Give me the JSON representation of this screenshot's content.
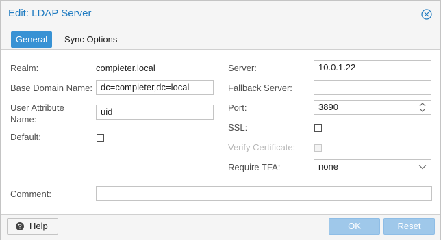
{
  "window": {
    "title": "Edit: LDAP Server"
  },
  "tabs": [
    {
      "label": "General",
      "active": true
    },
    {
      "label": "Sync Options",
      "active": false
    }
  ],
  "left": {
    "realm": {
      "label": "Realm:",
      "value": "compieter.local"
    },
    "base_domain": {
      "label": "Base Domain Name:",
      "value": "dc=compieter,dc=local"
    },
    "user_attribute": {
      "label_line1": "User Attribute",
      "label_line2": "Name:",
      "value": "uid"
    },
    "default": {
      "label": "Default:",
      "checked": false
    }
  },
  "right": {
    "server": {
      "label": "Server:",
      "value": "10.0.1.22"
    },
    "fallback": {
      "label": "Fallback Server:",
      "value": ""
    },
    "port": {
      "label": "Port:",
      "value": "3890"
    },
    "ssl": {
      "label": "SSL:",
      "checked": false
    },
    "verify": {
      "label": "Verify Certificate:",
      "checked": false,
      "disabled": true
    },
    "require_tfa": {
      "label": "Require TFA:",
      "value": "none"
    }
  },
  "comment": {
    "label": "Comment:",
    "value": ""
  },
  "footer": {
    "help_label": "Help",
    "ok_label": "OK",
    "reset_label": "Reset"
  },
  "icons": {
    "close": "close-icon",
    "help": "help-icon",
    "spinner": "spinner-icon",
    "dropdown": "chevron-down-icon"
  },
  "colors": {
    "accent": "#3892d4",
    "title": "#1f7bc1",
    "disabled_button": "#9fc8ea"
  }
}
